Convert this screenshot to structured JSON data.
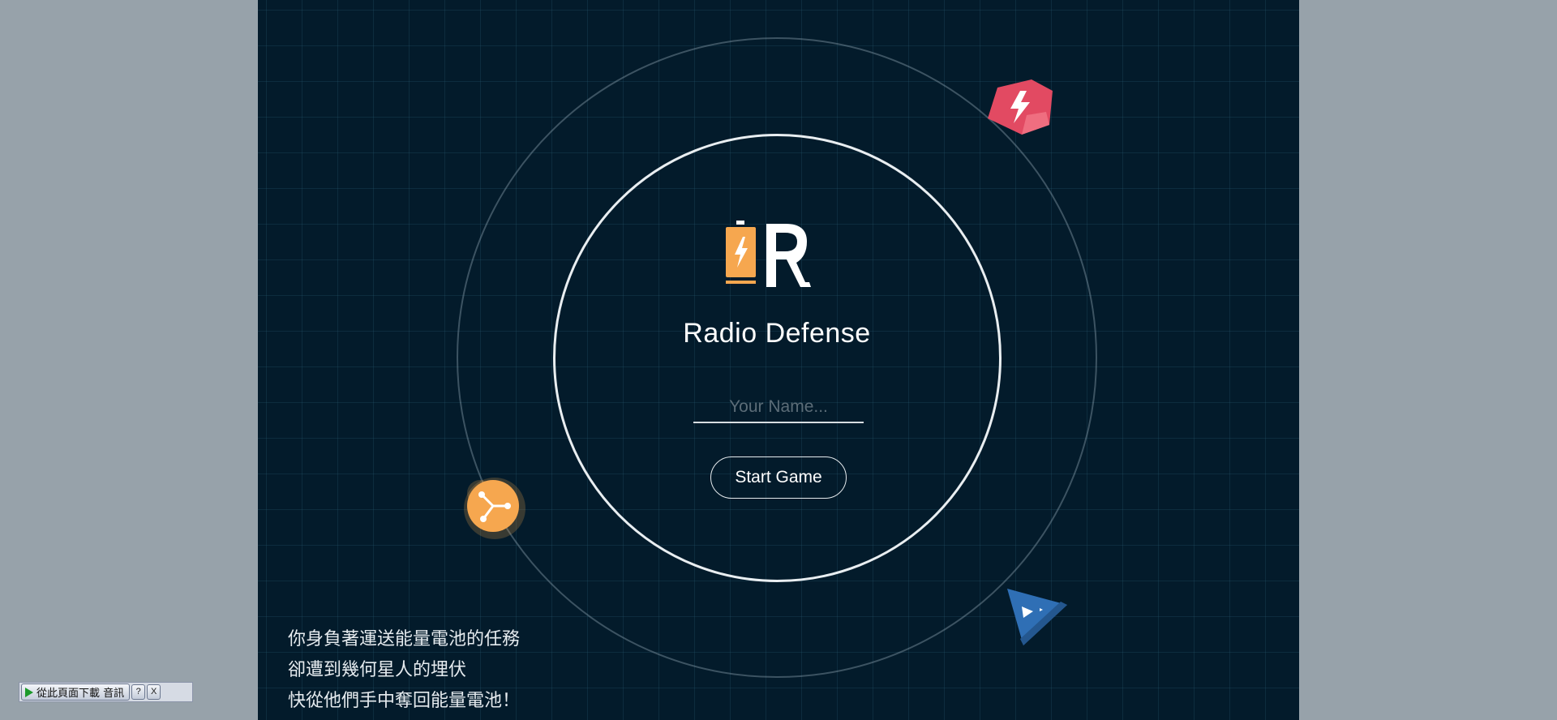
{
  "game": {
    "title": "Radio Defense",
    "name_placeholder": "Your Name...",
    "start_label": "Start Game",
    "story": [
      "你身負著運送能量電池的任務",
      "卻遭到幾何星人的埋伏",
      "快從他們手中奪回能量電池！"
    ]
  },
  "plugin_bar": {
    "download_label": "從此頁面下載 音訊",
    "help_label": "?",
    "close_label": "X"
  },
  "colors": {
    "background": "#031b2b",
    "page_bg": "#97a2aa",
    "battery": "#f6a74f",
    "enemy_red": "#e24a62",
    "enemy_orange": "#f6a74f",
    "enemy_blue": "#2f6fb5"
  },
  "icons": [
    "battery-icon",
    "letter-r-logo",
    "red-lightning-enemy-icon",
    "orange-node-enemy-icon",
    "blue-triangle-enemy-icon",
    "play-icon"
  ]
}
